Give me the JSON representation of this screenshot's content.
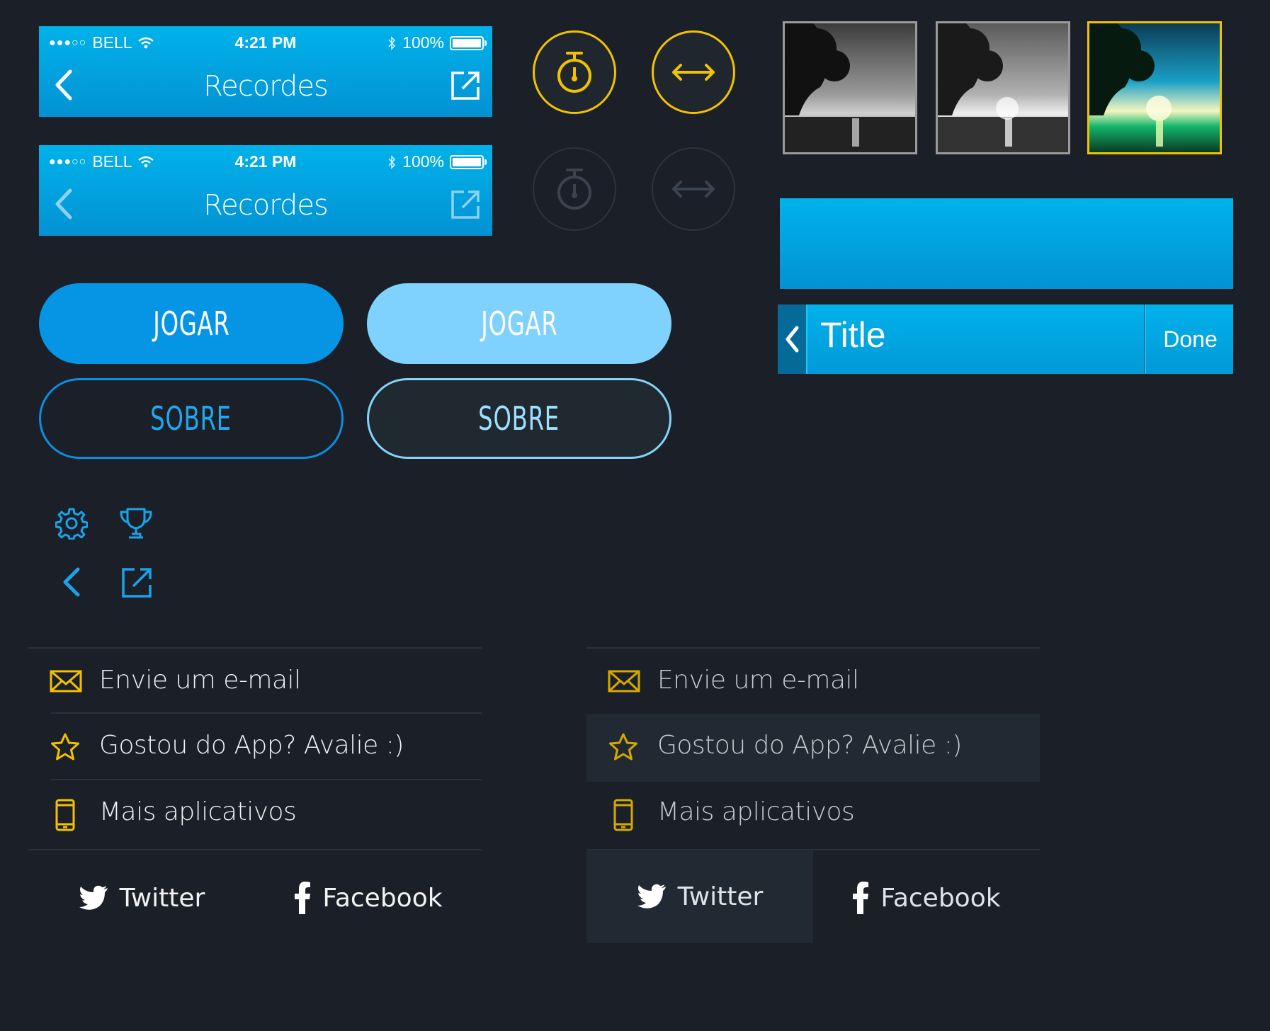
{
  "navbars": [
    {
      "carrier_dots": "●●●○○",
      "carrier": "BELL",
      "time": "4:21 PM",
      "battery": "100%",
      "title": "Recordes"
    },
    {
      "carrier_dots": "●●●○○",
      "carrier": "BELL",
      "time": "4:21 PM",
      "battery": "100%",
      "title": "Recordes"
    }
  ],
  "circle_buttons": [
    {
      "icon": "stopwatch-icon",
      "state": "active"
    },
    {
      "icon": "swap-arrows-icon",
      "state": "active"
    },
    {
      "icon": "stopwatch-icon",
      "state": "inactive"
    },
    {
      "icon": "swap-arrows-icon",
      "state": "inactive"
    }
  ],
  "thumbnails": [
    {
      "style": "grayscale",
      "selected": false
    },
    {
      "style": "grayscale-light",
      "selected": false
    },
    {
      "style": "color",
      "selected": true
    }
  ],
  "title_bar": {
    "title": "Title",
    "done_label": "Done"
  },
  "buttons": {
    "play_primary": "JOGAR",
    "play_light": "JOGAR",
    "about_outline": "SOBRE",
    "about_outline_light": "SOBRE"
  },
  "icons": [
    "gear-icon",
    "trophy-icon",
    "back-chevron-icon",
    "share-icon"
  ],
  "menu_left": {
    "items": [
      {
        "icon": "mail-icon",
        "label": "Envie um e-mail"
      },
      {
        "icon": "star-icon",
        "label": "Gostou do App? Avalie :)"
      },
      {
        "icon": "phone-icon",
        "label": "Mais aplicativos"
      }
    ],
    "twitter": "Twitter",
    "facebook": "Facebook"
  },
  "menu_right": {
    "items": [
      {
        "icon": "mail-icon",
        "label": "Envie um e-mail"
      },
      {
        "icon": "star-icon",
        "label": "Gostou do App? Avalie :)",
        "highlighted": true
      },
      {
        "icon": "phone-icon",
        "label": "Mais aplicativos"
      }
    ],
    "twitter": "Twitter",
    "facebook": "Facebook",
    "twitter_highlighted": true
  },
  "colors": {
    "background": "#1b1f27",
    "accent_blue": "#00b2ea",
    "accent_yellow": "#f2c200",
    "button_primary": "#0695e5",
    "button_light": "#7fd1fe",
    "highlight_row": "#212a33"
  }
}
